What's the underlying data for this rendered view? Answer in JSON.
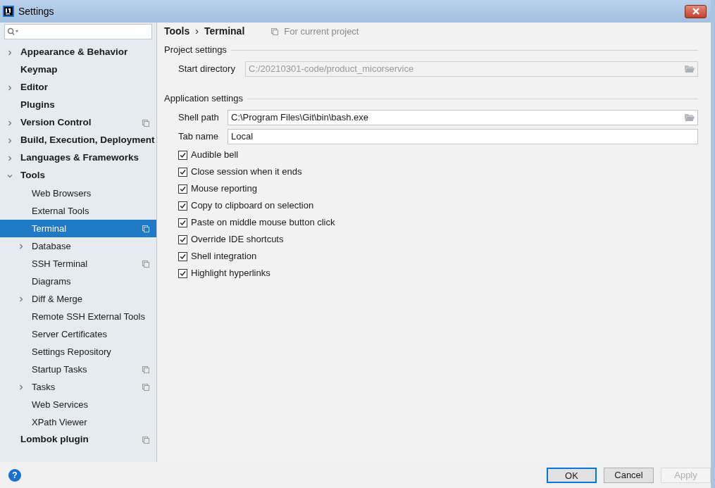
{
  "window": {
    "title": "Settings"
  },
  "sidebar": {
    "items": [
      {
        "label": "Appearance & Behavior",
        "selected": false,
        "expanded": false,
        "project_icon": false
      },
      {
        "label": "Keymap",
        "selected": false,
        "project_icon": false
      },
      {
        "label": "Editor",
        "selected": false,
        "expanded": false,
        "project_icon": false
      },
      {
        "label": "Plugins",
        "selected": false,
        "project_icon": false
      },
      {
        "label": "Version Control",
        "selected": false,
        "expanded": false,
        "project_icon": true
      },
      {
        "label": "Build, Execution, Deployment",
        "selected": false,
        "expanded": false,
        "project_icon": false
      },
      {
        "label": "Languages & Frameworks",
        "selected": false,
        "expanded": false,
        "project_icon": false
      },
      {
        "label": "Tools",
        "selected": false,
        "expanded": true,
        "project_icon": false,
        "children": [
          {
            "label": "Web Browsers",
            "selected": false,
            "project_icon": false
          },
          {
            "label": "External Tools",
            "selected": false,
            "project_icon": false
          },
          {
            "label": "Terminal",
            "selected": true,
            "project_icon": true
          },
          {
            "label": "Database",
            "selected": false,
            "expanded": false,
            "project_icon": false
          },
          {
            "label": "SSH Terminal",
            "selected": false,
            "project_icon": true
          },
          {
            "label": "Diagrams",
            "selected": false,
            "project_icon": false
          },
          {
            "label": "Diff & Merge",
            "selected": false,
            "expanded": false,
            "project_icon": false
          },
          {
            "label": "Remote SSH External Tools",
            "selected": false,
            "project_icon": false
          },
          {
            "label": "Server Certificates",
            "selected": false,
            "project_icon": false
          },
          {
            "label": "Settings Repository",
            "selected": false,
            "project_icon": false
          },
          {
            "label": "Startup Tasks",
            "selected": false,
            "project_icon": true
          },
          {
            "label": "Tasks",
            "selected": false,
            "expanded": false,
            "project_icon": true
          },
          {
            "label": "Web Services",
            "selected": false,
            "project_icon": false
          },
          {
            "label": "XPath Viewer",
            "selected": false,
            "project_icon": false
          }
        ]
      },
      {
        "label": "Lombok plugin",
        "selected": false,
        "project_icon": true
      }
    ]
  },
  "breadcrumb": [
    "Tools",
    "Terminal"
  ],
  "breadcrumb_separator": "›",
  "scope_note": "For current project",
  "sections": [
    {
      "title": "Project settings",
      "fields": [
        {
          "label": "Start directory",
          "value": "C:/20210301-code/product_micorservice",
          "disabled": true,
          "browse": true
        }
      ]
    },
    {
      "title": "Application settings",
      "fields": [
        {
          "label": "Shell path",
          "value": "C:\\Program Files\\Git\\bin\\bash.exe",
          "disabled": false,
          "browse": true
        },
        {
          "label": "Tab name",
          "value": "Local",
          "disabled": false,
          "browse": false
        }
      ],
      "checkboxes": [
        {
          "label": "Audible bell",
          "checked": true
        },
        {
          "label": "Close session when it ends",
          "checked": true
        },
        {
          "label": "Mouse reporting",
          "checked": true
        },
        {
          "label": "Copy to clipboard on selection",
          "checked": true
        },
        {
          "label": "Paste on middle mouse button click",
          "checked": true
        },
        {
          "label": "Override IDE shortcuts",
          "checked": true
        },
        {
          "label": "Shell integration",
          "checked": true
        },
        {
          "label": "Highlight hyperlinks",
          "checked": true
        }
      ]
    }
  ],
  "buttons": [
    {
      "label": "OK",
      "kind": "default",
      "disabled": false
    },
    {
      "label": "Cancel",
      "kind": "normal",
      "disabled": false
    },
    {
      "label": "Apply",
      "kind": "normal",
      "disabled": true
    }
  ],
  "help": "?"
}
